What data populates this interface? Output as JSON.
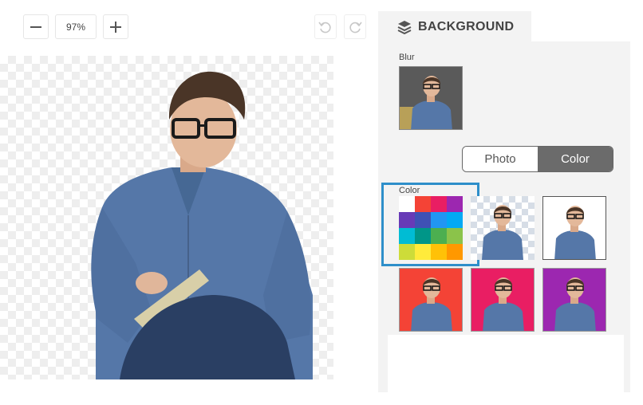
{
  "toolbar": {
    "zoom_out_icon": "minus-icon",
    "zoom_level": "97%",
    "zoom_in_icon": "plus-icon",
    "undo_icon": "undo-icon",
    "redo_icon": "redo-icon"
  },
  "panel": {
    "tab_icon": "layers-icon",
    "tab_label": "BACKGROUND",
    "blur_label": "Blur",
    "toggle": {
      "photo_label": "Photo",
      "color_label": "Color",
      "selected": "Color"
    },
    "color_label": "Color",
    "swatch_grid": [
      [
        "#ffffff",
        "#f44336",
        "#e91e63",
        "#9c27b0"
      ],
      [
        "#673ab7",
        "#3f51b5",
        "#2196f3",
        "#03a9f4"
      ],
      [
        "#00bcd4",
        "#009688",
        "#4caf50",
        "#8bc34a"
      ],
      [
        "#cddc39",
        "#ffeb3b",
        "#ffc107",
        "#ff9800"
      ]
    ],
    "backgrounds": [
      {
        "name": "transparent",
        "color": "checkerboard"
      },
      {
        "name": "white",
        "color": "#ffffff"
      },
      {
        "name": "red",
        "color": "#f44336"
      },
      {
        "name": "pink",
        "color": "#e91e63"
      },
      {
        "name": "purple",
        "color": "#9c27b0"
      }
    ]
  }
}
